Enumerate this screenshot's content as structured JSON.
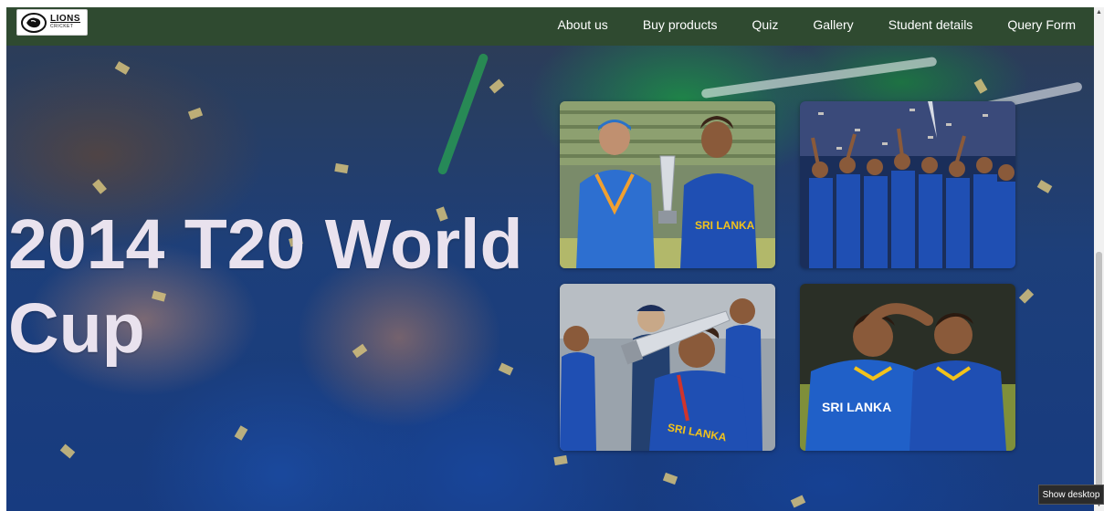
{
  "brand": {
    "logo_title": "LIONS",
    "logo_subtitle": "CRICKET"
  },
  "nav": {
    "items": [
      {
        "label": "About us"
      },
      {
        "label": "Buy products"
      },
      {
        "label": "Quiz"
      },
      {
        "label": "Gallery"
      },
      {
        "label": "Student details"
      },
      {
        "label": "Query Form"
      }
    ]
  },
  "hero": {
    "title": "2014 T20 World Cup"
  },
  "gallery": {
    "photos": [
      {
        "caption_on_shirt": "SRI LANKA"
      },
      {
        "caption_on_shirt": ""
      },
      {
        "caption_on_shirt": "SRI LANKA"
      },
      {
        "caption_on_shirt": "SRI LANKA"
      }
    ]
  },
  "taskbar": {
    "show_desktop": "Show desktop"
  },
  "colors": {
    "navbar": "#2f4a30",
    "hero_title": "#e9e2ee",
    "jersey_blue": "#1f4fb3",
    "jersey_yellow": "#f2c21b"
  }
}
